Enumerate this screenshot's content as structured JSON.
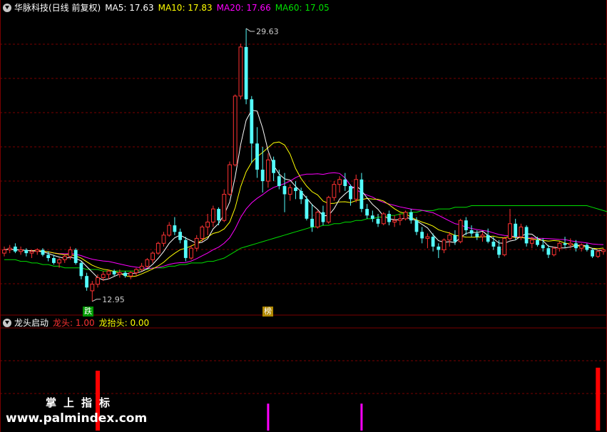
{
  "main_legend": {
    "title": "华脉科技(日线 前复权)",
    "ma5": "MA5: 17.63",
    "ma10": "MA10: 17.83",
    "ma20": "MA20: 17.66",
    "ma60": "MA60: 17.05"
  },
  "sub_legend": {
    "title": "龙头启动",
    "item1": "龙头: 1.00",
    "item2": "龙抬头: 0.00"
  },
  "annotations": {
    "high": "29.63",
    "low": "12.95",
    "tag_fall": "跌",
    "tag_list": "榜"
  },
  "watermark": {
    "line1": "掌上指标",
    "line2": "www.palmindex.com"
  },
  "colors": {
    "up": "#ff3232",
    "down": "#54fcfc",
    "ma5": "#ffffff",
    "ma10": "#ffff00",
    "ma20": "#ff00ff",
    "ma60": "#00e000",
    "grid": "#7a0000",
    "bar_red": "#ff0000",
    "bar_magenta": "#ff00ff",
    "tag_green": "#009900",
    "tag_gold": "#b08800"
  },
  "chart_data": {
    "type": "candlestick",
    "ylim": [
      12.2,
      30.5
    ],
    "candles": [
      [
        15.9,
        16.3,
        15.7,
        16.1
      ],
      [
        16.1,
        16.4,
        15.9,
        16.2
      ],
      [
        16.3,
        16.5,
        15.9,
        16.0
      ],
      [
        16.0,
        16.3,
        15.8,
        16.1
      ],
      [
        16.1,
        16.2,
        15.7,
        15.9
      ],
      [
        15.9,
        16.1,
        15.6,
        16.0
      ],
      [
        16.0,
        16.2,
        15.8,
        16.1
      ],
      [
        16.1,
        16.2,
        15.7,
        15.8
      ],
      [
        15.8,
        16.0,
        15.4,
        15.6
      ],
      [
        15.6,
        15.8,
        15.2,
        15.3
      ],
      [
        15.3,
        15.6,
        15.0,
        15.5
      ],
      [
        15.5,
        15.8,
        15.3,
        15.7
      ],
      [
        15.7,
        16.3,
        15.5,
        16.1
      ],
      [
        16.1,
        16.2,
        15.2,
        15.3
      ],
      [
        15.3,
        15.4,
        14.3,
        14.5
      ],
      [
        14.5,
        14.7,
        13.6,
        13.8
      ],
      [
        13.6,
        14.2,
        12.95,
        14.0
      ],
      [
        14.0,
        14.6,
        13.8,
        14.4
      ],
      [
        14.4,
        14.8,
        14.2,
        14.6
      ],
      [
        14.6,
        14.9,
        14.3,
        14.8
      ],
      [
        14.8,
        14.9,
        14.5,
        14.6
      ],
      [
        14.6,
        14.9,
        14.4,
        14.7
      ],
      [
        14.7,
        14.8,
        14.4,
        14.5
      ],
      [
        14.5,
        14.8,
        14.3,
        14.7
      ],
      [
        14.7,
        15.0,
        14.5,
        14.9
      ],
      [
        14.9,
        15.3,
        14.8,
        15.1
      ],
      [
        15.1,
        15.6,
        15.0,
        15.5
      ],
      [
        15.5,
        16.0,
        15.3,
        15.9
      ],
      [
        15.9,
        16.6,
        15.8,
        16.5
      ],
      [
        16.5,
        17.2,
        16.3,
        17.0
      ],
      [
        17.0,
        17.8,
        16.9,
        17.6
      ],
      [
        17.6,
        18.1,
        17.0,
        17.2
      ],
      [
        17.2,
        17.4,
        16.5,
        16.7
      ],
      [
        16.7,
        16.9,
        15.4,
        15.6
      ],
      [
        15.6,
        16.4,
        15.5,
        16.2
      ],
      [
        16.2,
        17.0,
        16.0,
        16.8
      ],
      [
        16.8,
        17.6,
        16.6,
        17.5
      ],
      [
        17.5,
        18.3,
        17.0,
        17.8
      ],
      [
        17.8,
        18.8,
        17.5,
        18.6
      ],
      [
        18.6,
        18.7,
        17.6,
        17.9
      ],
      [
        17.9,
        19.8,
        17.8,
        19.5
      ],
      [
        19.5,
        21.5,
        19.4,
        21.3
      ],
      [
        21.3,
        25.6,
        21.2,
        25.5
      ],
      [
        25.5,
        28.7,
        25.3,
        28.5
      ],
      [
        28.5,
        29.63,
        25.0,
        25.3
      ],
      [
        25.3,
        25.5,
        21.4,
        22.6
      ],
      [
        22.6,
        23.6,
        20.5,
        21.0
      ],
      [
        21.0,
        22.4,
        19.6,
        20.3
      ],
      [
        20.3,
        22.0,
        19.9,
        21.6
      ],
      [
        21.6,
        21.8,
        20.3,
        20.8
      ],
      [
        20.6,
        21.0,
        19.8,
        20.0
      ],
      [
        20.0,
        20.8,
        18.4,
        19.5
      ],
      [
        19.5,
        20.1,
        19.1,
        19.9
      ],
      [
        19.9,
        20.3,
        19.2,
        19.7
      ],
      [
        19.7,
        19.9,
        18.9,
        19.2
      ],
      [
        19.2,
        19.4,
        17.9,
        18.0
      ],
      [
        18.0,
        18.9,
        17.2,
        17.5
      ],
      [
        17.5,
        18.5,
        17.4,
        18.4
      ],
      [
        18.4,
        18.8,
        17.6,
        17.8
      ],
      [
        17.8,
        19.4,
        17.7,
        19.3
      ],
      [
        19.3,
        20.3,
        19.1,
        20.1
      ],
      [
        20.1,
        20.6,
        19.6,
        20.4
      ],
      [
        20.4,
        20.8,
        19.7,
        20.0
      ],
      [
        20.0,
        20.1,
        18.8,
        19.2
      ],
      [
        19.2,
        20.7,
        19.0,
        20.4
      ],
      [
        20.4,
        20.8,
        18.4,
        18.6
      ],
      [
        18.6,
        18.9,
        18.0,
        18.2
      ],
      [
        18.2,
        18.5,
        17.8,
        18.0
      ],
      [
        18.0,
        18.3,
        17.5,
        17.7
      ],
      [
        17.7,
        18.4,
        17.6,
        18.3
      ],
      [
        18.3,
        18.5,
        17.6,
        17.8
      ],
      [
        17.8,
        18.2,
        17.5,
        17.9
      ],
      [
        17.9,
        18.3,
        17.6,
        18.0
      ],
      [
        18.0,
        18.5,
        17.9,
        18.4
      ],
      [
        18.4,
        18.6,
        17.7,
        17.9
      ],
      [
        17.9,
        18.1,
        17.0,
        17.2
      ],
      [
        17.2,
        17.5,
        16.5,
        16.8
      ],
      [
        16.8,
        17.1,
        16.2,
        16.9
      ],
      [
        16.9,
        17.1,
        16.0,
        16.3
      ],
      [
        16.3,
        16.5,
        15.6,
        16.1
      ],
      [
        16.1,
        16.8,
        15.9,
        16.7
      ],
      [
        16.7,
        17.2,
        16.3,
        17.0
      ],
      [
        17.0,
        17.3,
        16.4,
        16.6
      ],
      [
        16.6,
        18.0,
        16.5,
        17.9
      ],
      [
        17.9,
        18.1,
        17.0,
        17.3
      ],
      [
        17.3,
        17.6,
        16.9,
        17.1
      ],
      [
        17.1,
        17.3,
        16.7,
        16.9
      ],
      [
        16.9,
        17.2,
        16.6,
        17.0
      ],
      [
        17.0,
        17.4,
        16.5,
        16.6
      ],
      [
        16.6,
        16.9,
        16.1,
        16.3
      ],
      [
        16.3,
        16.7,
        15.6,
        15.8
      ],
      [
        15.8,
        16.9,
        15.7,
        16.8
      ],
      [
        16.8,
        18.6,
        16.7,
        17.7
      ],
      [
        17.7,
        18.0,
        16.7,
        16.9
      ],
      [
        16.9,
        17.7,
        16.7,
        17.5
      ],
      [
        17.5,
        17.6,
        16.3,
        16.5
      ],
      [
        16.5,
        16.9,
        16.2,
        16.7
      ],
      [
        16.7,
        16.9,
        16.3,
        16.4
      ],
      [
        16.4,
        16.8,
        16.0,
        16.2
      ],
      [
        16.2,
        16.4,
        15.6,
        15.8
      ],
      [
        15.8,
        16.3,
        15.7,
        16.2
      ],
      [
        16.2,
        16.6,
        16.0,
        16.5
      ],
      [
        16.5,
        16.9,
        16.2,
        16.4
      ],
      [
        16.4,
        16.8,
        16.2,
        16.5
      ],
      [
        16.5,
        16.7,
        16.0,
        16.2
      ],
      [
        16.2,
        16.5,
        16.0,
        16.4
      ],
      [
        16.4,
        16.5,
        16.0,
        16.1
      ],
      [
        16.1,
        16.2,
        15.6,
        15.7
      ],
      [
        15.7,
        16.1,
        15.6,
        16.0
      ],
      [
        16.0,
        16.2,
        15.8,
        16.1
      ]
    ],
    "ma60": [
      15.5,
      15.5,
      15.5,
      15.4,
      15.4,
      15.3,
      15.3,
      15.2,
      15.2,
      15.1,
      15.1,
      15.0,
      15.0,
      15.0,
      15.0,
      14.9,
      14.9,
      14.9,
      14.8,
      14.8,
      14.8,
      14.8,
      14.8,
      14.8,
      14.8,
      14.9,
      14.9,
      15.0,
      15.0,
      15.0,
      15.1,
      15.1,
      15.2,
      15.2,
      15.3,
      15.3,
      15.3,
      15.4,
      15.4,
      15.5,
      15.6,
      15.8,
      16.0,
      16.2,
      16.3,
      16.4,
      16.5,
      16.6,
      16.7,
      16.8,
      16.9,
      17.0,
      17.1,
      17.2,
      17.3,
      17.4,
      17.5,
      17.5,
      17.6,
      17.6,
      17.7,
      17.7,
      17.8,
      17.8,
      17.9,
      17.9,
      18.0,
      18.0,
      18.1,
      18.1,
      18.2,
      18.2,
      18.3,
      18.3,
      18.4,
      18.4,
      18.5,
      18.5,
      18.5,
      18.6,
      18.6,
      18.6,
      18.7,
      18.7,
      18.7,
      18.8,
      18.8,
      18.8,
      18.8,
      18.8,
      18.8,
      18.8,
      18.8,
      18.8,
      18.8,
      18.8,
      18.8,
      18.8,
      18.8,
      18.8,
      18.8,
      18.8,
      18.8,
      18.8,
      18.8,
      18.8,
      18.8,
      18.7,
      18.6,
      18.5,
      18.4,
      18.3,
      18.2
    ],
    "sub_bars": [
      {
        "index": 17,
        "value": 1.0,
        "series": "龙头"
      },
      {
        "index": 48,
        "value": 0.45,
        "series": "other"
      },
      {
        "index": 65,
        "value": 0.45,
        "series": "other"
      },
      {
        "index": 108,
        "value": 1.05,
        "series": "龙头"
      }
    ]
  }
}
